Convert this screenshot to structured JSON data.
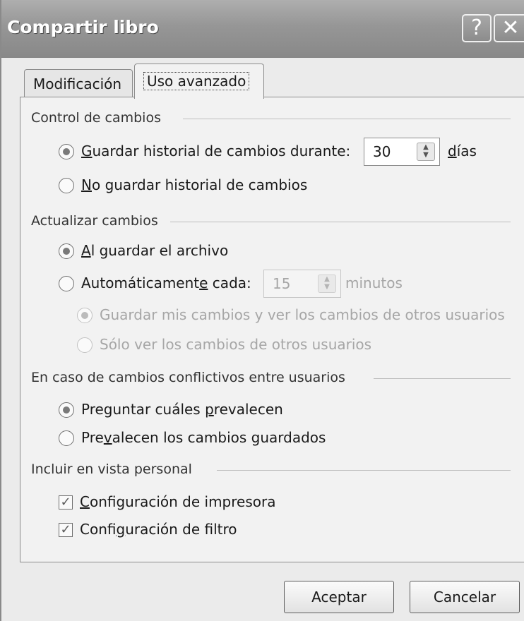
{
  "window": {
    "title": "Compartir libro",
    "help_glyph": "?",
    "close_glyph": "✕"
  },
  "tabs": [
    {
      "label": "Modificación",
      "active": false
    },
    {
      "label": "Uso avanzado",
      "active": true
    }
  ],
  "groups": {
    "control": {
      "label": "Control de cambios",
      "keep_history": {
        "pre": "",
        "u": "G",
        "post": "uardar historial de cambios durante:",
        "selected": true
      },
      "days_value": "30",
      "days_label_u": "d",
      "days_label_post": "ías",
      "no_history": {
        "pre": "",
        "u": "N",
        "post": "o guardar historial de cambios",
        "selected": false
      }
    },
    "update": {
      "label": "Actualizar cambios",
      "on_save": {
        "pre": "",
        "u": "A",
        "post": "l guardar el archivo",
        "selected": true
      },
      "auto": {
        "pre": "Automáticament",
        "u": "e",
        "post": " cada:",
        "selected": false
      },
      "minutes_value": "15",
      "minutes_label": "minutos",
      "save_and_view": {
        "label": "Guardar mis cambios y ver los cambios de otros usuarios",
        "selected": true
      },
      "view_only": {
        "label": "Sólo ver los cambios de otros usuarios",
        "selected": false
      }
    },
    "conflicts": {
      "label": "En caso de cambios conflictivos entre usuarios",
      "ask": {
        "pre": "Preguntar cuáles ",
        "u": "p",
        "post": "revalecen",
        "selected": true
      },
      "saved_win": {
        "pre": "Pre",
        "u": "v",
        "post": "alecen los cambios guardados",
        "selected": false
      }
    },
    "personal": {
      "label": "Incluir en vista personal",
      "print": {
        "pre": "",
        "u": "C",
        "post": "onfiguración de impresora",
        "checked": true
      },
      "filter": {
        "pre": "Confi",
        "u": "g",
        "post": "uración de filtro",
        "checked": true
      }
    }
  },
  "buttons": {
    "ok": "Aceptar",
    "cancel": "Cancelar"
  }
}
